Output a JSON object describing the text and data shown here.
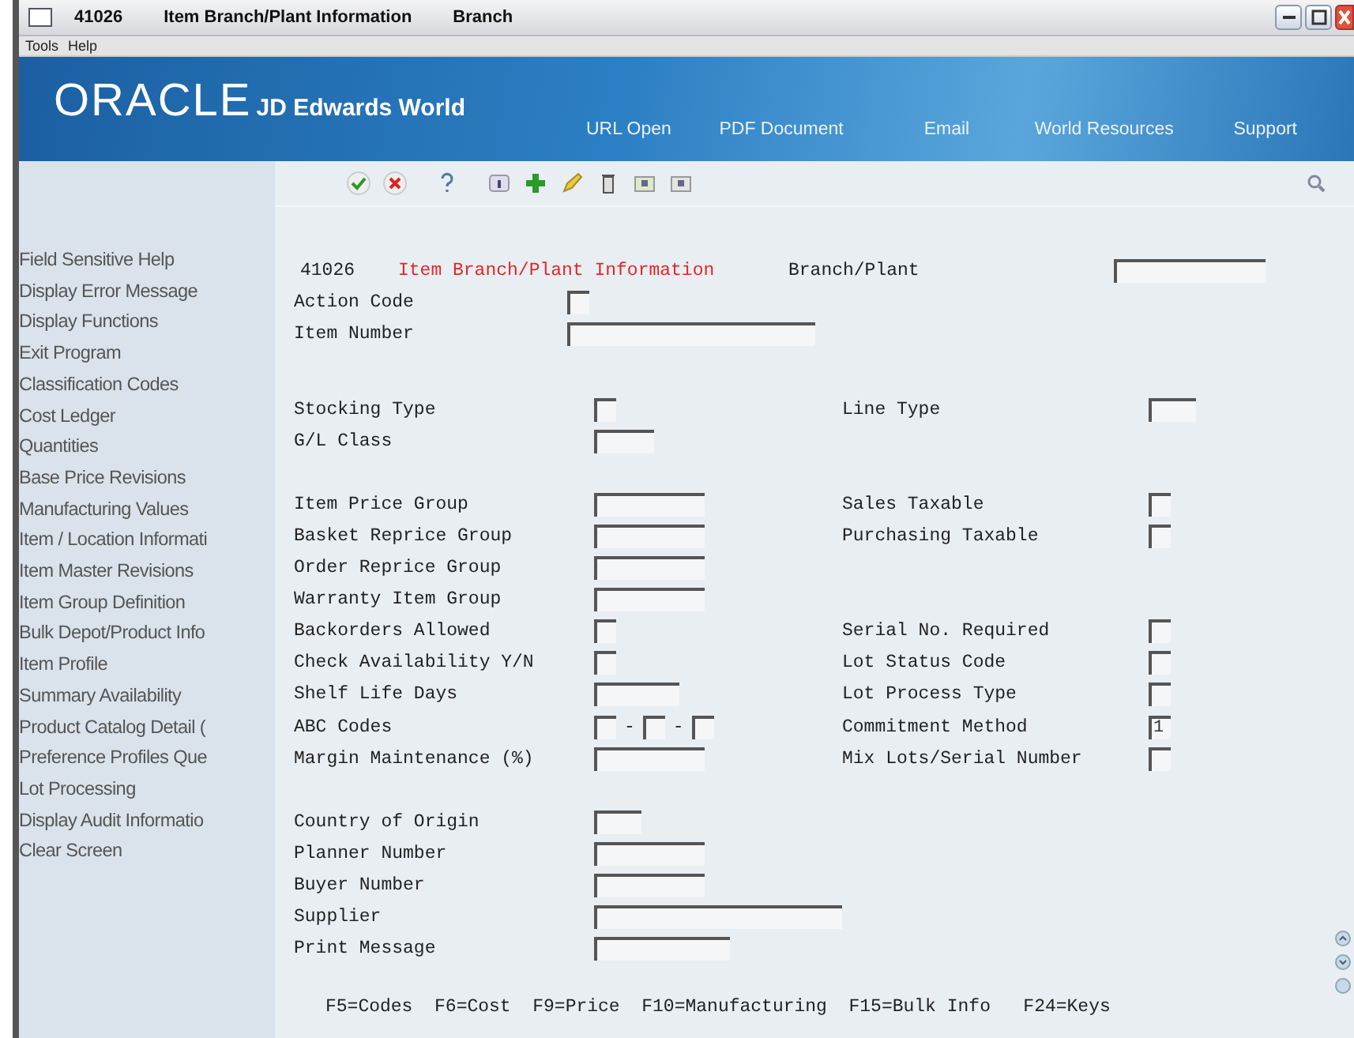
{
  "window": {
    "program": "41026",
    "title": "Item Branch/Plant Information",
    "subtitle": "Branch"
  },
  "menu": [
    "Tools",
    "Help"
  ],
  "banner": {
    "brand": "ORACLE",
    "product": "JD Edwards World",
    "links": [
      "URL Open",
      "PDF Document",
      "Email",
      "World Resources",
      "Support"
    ]
  },
  "sidebar": {
    "items": [
      "Field Sensitive Help",
      "Display Error Message",
      "Display Functions",
      "Exit Program",
      "Classification Codes",
      "Cost Ledger",
      "Quantities",
      "Base Price Revisions",
      "Manufacturing Values",
      "Item / Location Informati",
      "Item Master Revisions",
      "Item Group Definition",
      "Bulk Depot/Product Info",
      "Item Profile",
      "Summary Availability",
      "Product Catalog Detail (",
      "Preference Profiles Que",
      "Lot Processing",
      "Display Audit Informatio",
      "Clear Screen"
    ]
  },
  "form": {
    "program": "41026",
    "title": "Item Branch/Plant Information",
    "branch_label": "Branch/Plant",
    "groups": [
      [
        {
          "kind": "field",
          "label": "Action Code"
        },
        {
          "kind": "field",
          "label": "Item Number"
        }
      ],
      [
        {
          "kind": "field",
          "label": "Stocking Type",
          "right_label": "Line Type"
        },
        {
          "kind": "field",
          "label": "G/L Class"
        }
      ],
      [
        {
          "kind": "field",
          "label": "Item Price Group",
          "right_label": "Sales Taxable"
        },
        {
          "kind": "field",
          "label": "Basket Reprice Group",
          "right_label": "Purchasing Taxable"
        },
        {
          "kind": "field",
          "label": "Order Reprice Group"
        },
        {
          "kind": "field",
          "label": "Warranty Item Group"
        },
        {
          "kind": "field",
          "label": "Backorders Allowed",
          "right_label": "Serial No. Required"
        },
        {
          "kind": "field",
          "label": "Check Availability Y/N",
          "right_label": "Lot Status Code"
        },
        {
          "kind": "field",
          "label": "Shelf Life Days",
          "right_label": "Lot Process Type"
        },
        {
          "kind": "abc",
          "label": "ABC Codes",
          "separators": [
            "-",
            "-"
          ],
          "right_label": "Commitment Method",
          "right_value": "1"
        },
        {
          "kind": "field",
          "label": "Margin Maintenance (%)",
          "right_label": "Mix Lots/Serial Number"
        }
      ],
      [
        {
          "kind": "field",
          "label": "Country of Origin"
        },
        {
          "kind": "field",
          "label": "Planner Number"
        },
        {
          "kind": "field",
          "label": "Buyer Number"
        },
        {
          "kind": "field",
          "label": "Supplier"
        },
        {
          "kind": "field",
          "label": "Print Message"
        }
      ]
    ],
    "function_keys": "F5=Codes  F6=Cost  F9=Price  F10=Manufacturing  F15=Bulk Info   F24=Keys"
  }
}
